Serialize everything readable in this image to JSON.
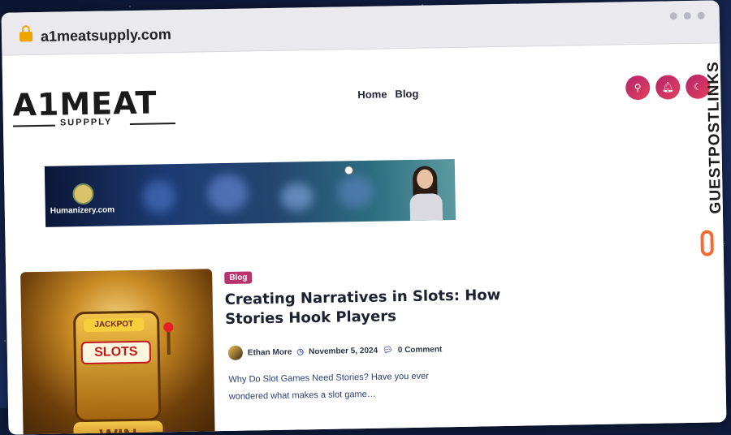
{
  "browser": {
    "url": "a1meatsupply.com"
  },
  "header": {
    "logo_main": "A1MEAT",
    "logo_sub": "SUPPPLY",
    "nav": [
      {
        "label": "Home"
      },
      {
        "label": "Blog"
      }
    ],
    "icons": [
      "search-icon",
      "bell-icon",
      "moon-icon"
    ]
  },
  "banner": {
    "brand": "Humanizery.com"
  },
  "post": {
    "category": "Blog",
    "title": "Creating Narratives in Slots: How Stories Hook Players",
    "author": "Ethan More",
    "date": "November 5, 2024",
    "comments": "0 Comment",
    "excerpt": "Why Do Slot Games Need Stories? Have you ever wondered what makes a slot game…",
    "thumb_jackpot": "JACKPOT",
    "thumb_slots": "SLOTS",
    "thumb_win": "WIN"
  },
  "sidebar": {
    "watermark": "GUESTPOSTLINKS"
  },
  "colors": {
    "accent": "#b6256b",
    "badge": "#b8336b",
    "link": "#2a3d7a"
  }
}
